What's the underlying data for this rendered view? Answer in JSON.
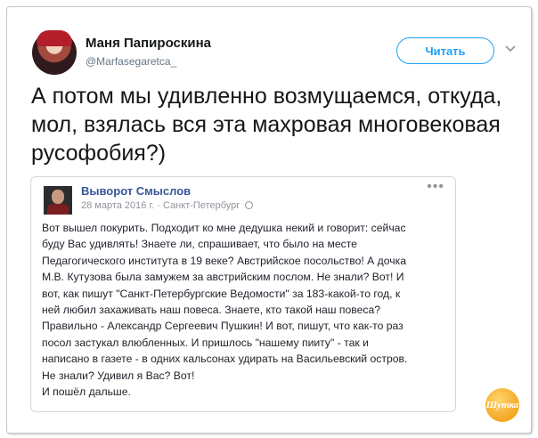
{
  "tweet": {
    "author_name": "Маня Папироскина",
    "author_handle": "@Marfasegaretca_",
    "follow_label": "Читать",
    "text": "А потом мы удивленно возмущаемся, откуда, мол, взялась вся эта махровая многовековая русофобия?)",
    "colors": {
      "accent": "#1da1f2",
      "text": "#14171a",
      "muted": "#657786"
    }
  },
  "embedded_post": {
    "page_name": "Выворот Смыслов",
    "date": "28 марта 2016 г.",
    "location": "Санкт-Петербург",
    "menu_glyph": "•••",
    "text": "Вот вышел покурить. Подходит ко мне дедушка некий и говорит: сейчас\nбуду Вас удивлять! Знаете ли, спрашивает, что было на месте\nПедагогического института в 19 веке? Австрийское посольство! А дочка\nМ.В. Кутузова была замужем за австрийским послом. Не знали? Вот! И\nвот, как пишут \"Санкт-Петербургские Ведомости\" за 183-какой-то год, к\nней любил захаживать наш повеса. Знаете, кто такой наш повеса?\nПравильно - Александр Сергеевич Пушкин! И вот, пишут, что как-то раз\nпосол застукал влюбленных. И пришлось \"нашему пииту\" - так и\nнаписано в газете - в одних кальсонах удирать на Васильевский остров.\nНе знали? Удивил я Вас? Вот!\nИ пошёл дальше.",
    "colors": {
      "link": "#365899",
      "meta": "#90949c"
    }
  },
  "watermark": {
    "label": "Шутка"
  }
}
